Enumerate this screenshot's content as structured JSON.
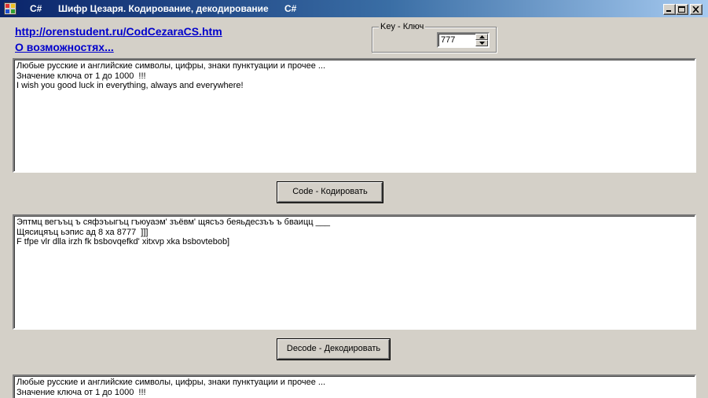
{
  "window": {
    "title_parts": [
      "C#",
      "Шифр Цезаря. Кодирование, декодирование",
      "C#"
    ],
    "controls": [
      "minimize-icon",
      "maximize-icon",
      "close-icon"
    ]
  },
  "links": {
    "site": "http://orenstudent.ru/CodCezaraCS.htm",
    "about": "О возможностях..."
  },
  "key_group": {
    "legend": "Key - Ключ",
    "value": "777"
  },
  "input_text": {
    "lines": [
      "Любые русские и английские символы, цифры, знаки пунктуации и прочее ...",
      "Значение ключа от 1 до 1000  !!!",
      "I wish you good luck in everything, always and everywhere!"
    ]
  },
  "code_button": {
    "label": "Code - Кодировать"
  },
  "encoded_text": {
    "lines": [
      "Эптмц вегъъц ъ сяфэъыгъц гъюуаэм' зъёвм' щясъэ беяьдесзъъ ъ бваицц ___",
      "Щясицяъц ьэпис ад 8 ха 8777  ]]]",
      "F tfpe vlr dlla irzh fk bsbovqefkd' xitxvp xka bsbovtebob]"
    ]
  },
  "decode_button": {
    "label": "Decode - Декодировать"
  },
  "decoded_text": {
    "lines": [
      "Любые русские и английские символы, цифры, знаки пунктуации и прочее ...",
      "Значение ключа от 1 до 1000  !!!"
    ]
  }
}
